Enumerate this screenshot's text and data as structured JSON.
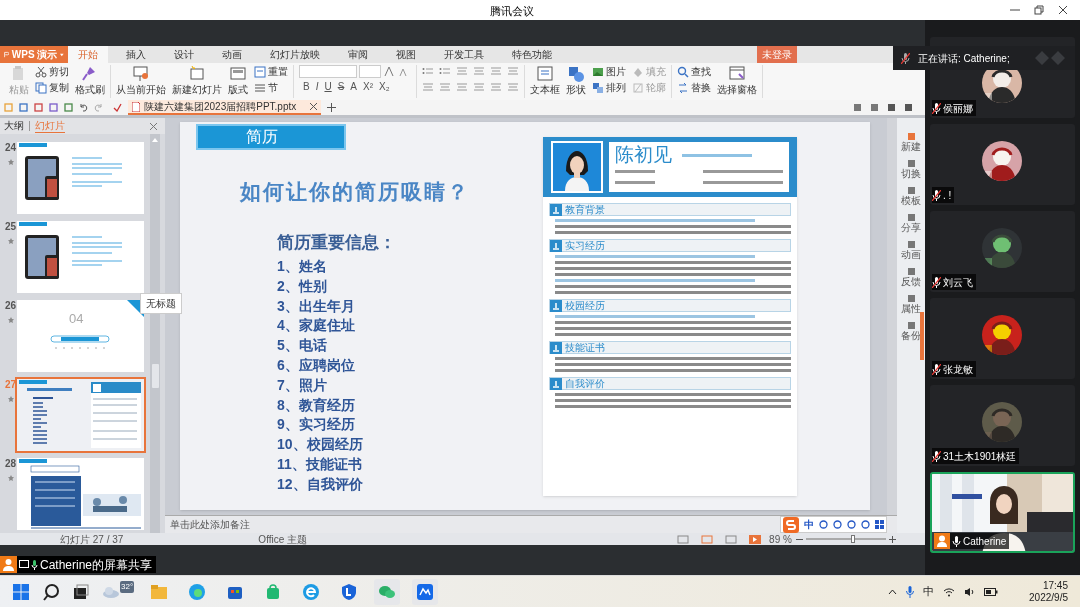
{
  "window": {
    "title": "腾讯会议"
  },
  "wps": {
    "app_button": "WPS 演示",
    "tabs": [
      {
        "label": "开始",
        "selected": true
      },
      {
        "label": "插入",
        "selected": false
      },
      {
        "label": "设计",
        "selected": false
      },
      {
        "label": "动画",
        "selected": false
      },
      {
        "label": "幻灯片放映",
        "selected": false
      },
      {
        "label": "审阅",
        "selected": false
      },
      {
        "label": "视图",
        "selected": false
      },
      {
        "label": "开发工具",
        "selected": false
      },
      {
        "label": "特色功能",
        "selected": false
      }
    ],
    "login": "未登录",
    "ribbon": [
      {
        "kind": "items",
        "items": [
          {
            "kind": "large",
            "label": "粘贴",
            "disabled": true
          },
          {
            "kind": "small",
            "label": "剪切",
            "disabled": false
          },
          {
            "kind": "small",
            "label": "复制",
            "disabled": false
          },
          {
            "kind": "large",
            "label": "格式刷",
            "disabled": false
          }
        ]
      },
      {
        "kind": "items",
        "items": [
          {
            "kind": "large",
            "label": "从当前开始",
            "disabled": false
          },
          {
            "kind": "large",
            "label": "新建幻灯片",
            "disabled": false
          },
          {
            "kind": "large",
            "label": "版式",
            "disabled": false
          },
          {
            "kind": "small",
            "label": "重置",
            "disabled": false
          },
          {
            "kind": "small",
            "label": "节",
            "disabled": false
          }
        ]
      },
      {
        "kind": "font",
        "buttons": [
          "B",
          "I",
          "U",
          "S",
          "A",
          "X²",
          "X₂"
        ]
      },
      {
        "kind": "paragraph"
      },
      {
        "kind": "items",
        "items": [
          {
            "kind": "large",
            "label": "文本框",
            "disabled": false
          },
          {
            "kind": "large",
            "label": "形状",
            "disabled": false
          },
          {
            "kind": "small",
            "label": "图片",
            "disabled": false
          },
          {
            "kind": "small",
            "label": "排列",
            "disabled": false
          },
          {
            "kind": "small",
            "label": "填充",
            "disabled": true
          },
          {
            "kind": "small",
            "label": "轮廓",
            "disabled": true
          }
        ]
      },
      {
        "kind": "items",
        "items": [
          {
            "kind": "small",
            "label": "查找",
            "disabled": false
          },
          {
            "kind": "small",
            "label": "替换",
            "disabled": false
          },
          {
            "kind": "large",
            "label": "选择窗格",
            "disabled": false
          }
        ]
      }
    ],
    "document_tab": "陕建六建集团2023届招聘PPT.pptx",
    "panel_tabs": [
      {
        "label": "大纲",
        "selected": false
      },
      {
        "label": "幻灯片",
        "selected": true
      }
    ],
    "slides": [
      {
        "number": "24",
        "kind": "photo_text",
        "selected": false
      },
      {
        "number": "25",
        "kind": "photo_text",
        "selected": false
      },
      {
        "number": "26",
        "kind": "section",
        "heading": "04",
        "selected": false
      },
      {
        "number": "27",
        "kind": "resume",
        "selected": true
      },
      {
        "number": "28",
        "kind": "meeting",
        "selected": false
      }
    ],
    "tooltip": "无标题",
    "slide": {
      "header": "简历",
      "title": "如何让你的简历吸睛？",
      "list_title": "简历重要信息：",
      "list": [
        "1、姓名",
        "2、性别",
        "3、出生年月",
        "4、家庭住址",
        "5、电话",
        "6、应聘岗位",
        "7、照片",
        "8、教育经历",
        "9、实习经历",
        "10、校园经历",
        "11、技能证书",
        "12、自我评价"
      ],
      "resume": {
        "name": "陈初见",
        "sections": [
          "教育背景",
          "实习经历",
          "校园经历",
          "技能证书",
          "自我评价"
        ]
      }
    },
    "notes_placeholder": "单击此处添加备注",
    "side_tools": [
      "新建",
      "切换",
      "模板",
      "分享",
      "动画",
      "反馈",
      "属性",
      "备份"
    ],
    "status": {
      "slide_count": "幻灯片 27 / 37",
      "theme": "Office 主题",
      "zoom": "89 %",
      "zoom_slider": {
        "level": 0.6
      }
    },
    "ime": "中"
  },
  "share_label": "Catherine的屏幕共享",
  "speaking": "正在讲话: Catherine;",
  "participants": [
    {
      "name": "侯丽娜",
      "muted": true,
      "kind": "avatar"
    },
    {
      "name": ". !",
      "muted": true,
      "kind": "avatar"
    },
    {
      "name": "刘云飞",
      "muted": true,
      "kind": "avatar"
    },
    {
      "name": "张龙敏",
      "muted": true,
      "kind": "avatar"
    },
    {
      "name": "31土木1901林廷",
      "muted": true,
      "kind": "avatar"
    },
    {
      "name": "Catherine",
      "muted": false,
      "kind": "video"
    }
  ],
  "taskbar": {
    "weather": "32°",
    "ime": "中",
    "time": "17:45",
    "date": "2022/9/5"
  }
}
